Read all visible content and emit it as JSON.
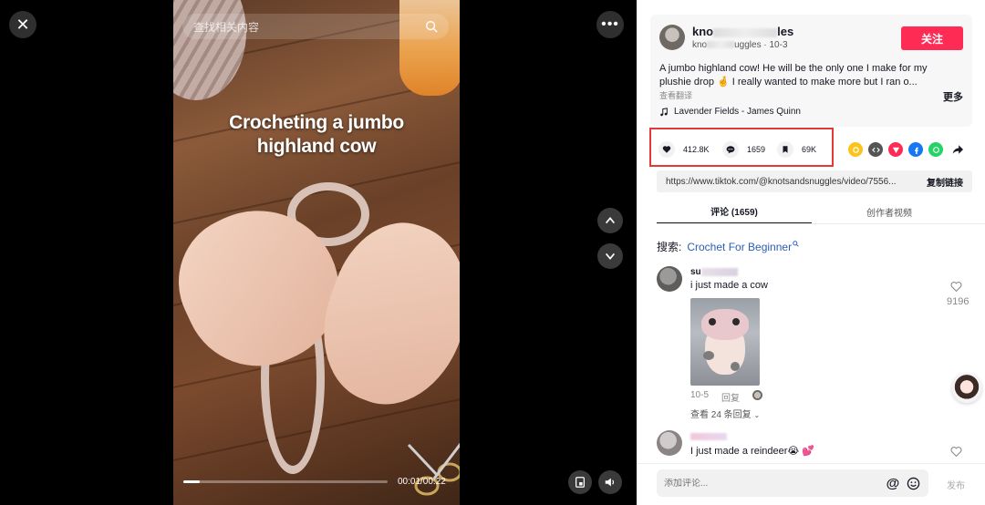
{
  "video": {
    "search_placeholder": "查找相关内容",
    "overlay_title_line1": "Crocheting a jumbo",
    "overlay_title_line2": "highland cow",
    "time": "00:01/00:22",
    "progress_fraction": 0.08
  },
  "author": {
    "name": "knotsandsnuggles",
    "name_visible_start": "kno",
    "name_visible_end": "les",
    "handle_visible_start": "kno",
    "handle_visible_end": "uggles",
    "date": "10-3",
    "follow_label": "关注"
  },
  "description": {
    "line1": "A jumbo highland cow! He will be the only one I make for my",
    "line2": "plushie drop 🤞 I really wanted to make more but I ran o...",
    "more_label": "更多",
    "translate_label": "查看翻译",
    "music": "Lavender Fields - James Quinn"
  },
  "stats": {
    "likes": "412.8K",
    "comments": "1659",
    "saves": "69K"
  },
  "share_icons": [
    {
      "name": "friends-share-icon",
      "color": "#fcc31d"
    },
    {
      "name": "embed-icon",
      "color": "#555555"
    },
    {
      "name": "direct-share-icon",
      "color": "#fe2c55"
    },
    {
      "name": "facebook-icon",
      "color": "#1877f2"
    },
    {
      "name": "whatsapp-icon",
      "color": "#25d366"
    },
    {
      "name": "share-arrow-icon",
      "color": "#161823"
    }
  ],
  "link": {
    "url": "https://www.tiktok.com/@knotsandsnuggles/video/7556...",
    "copy_label": "复制链接"
  },
  "tabs": {
    "comments": "评论 (1659)",
    "creator_videos": "创作者视频"
  },
  "search_suggestion": {
    "label": "搜索:",
    "keyword": "Crochet For Beginner"
  },
  "comments": [
    {
      "name_visible_start": "su",
      "text": "i just made a cow",
      "likes": "9196",
      "date": "10-5",
      "reply_label": "回复",
      "view_replies": "查看 24 条回复"
    },
    {
      "text": "I just made a reindeer😭 💕"
    }
  ],
  "composer": {
    "placeholder": "添加评论...",
    "publish_label": "发布"
  },
  "colors": {
    "accent": "#fe2c55",
    "highlight_box": "#e53935",
    "link_blue": "#2b5db6"
  }
}
